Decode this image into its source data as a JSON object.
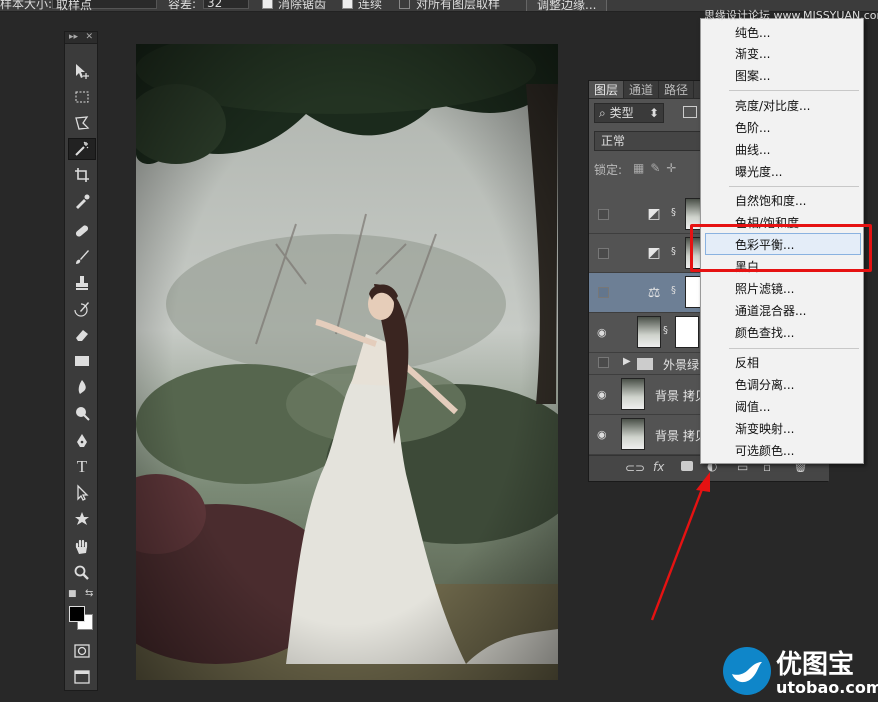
{
  "options_bar": {
    "sample_size_label": "样本大小:",
    "sample_size_value": "取样点",
    "tolerance_label": "容差:",
    "tolerance_value": "32",
    "antialias_label": "消除锯齿",
    "contiguous_label": "连续",
    "all_layers_label": "对所有图层取样",
    "refine_edge_label": "调整边缘..."
  },
  "tools_panel": {
    "header_left": "▸▸",
    "header_right": "✕",
    "tools": [
      "move",
      "marquee",
      "lasso",
      "magic-wand",
      "crop",
      "eyedropper",
      "healing-brush",
      "brush",
      "clone-stamp",
      "history-brush",
      "eraser",
      "gradient",
      "blur",
      "dodge",
      "pen",
      "type",
      "path-selection",
      "shape",
      "hand",
      "zoom"
    ],
    "selected_tool": "magic-wand",
    "foreground_color": "#000000",
    "background_color": "#ffffff"
  },
  "layers_panel": {
    "tabs": [
      "图层",
      "通道",
      "路径"
    ],
    "active_tab": "图层",
    "filter_label": "类型",
    "blend_mode": "正常",
    "lock_label": "锁定:",
    "layers": [
      {
        "name": "",
        "visible": false,
        "type": "curves"
      },
      {
        "name": "",
        "visible": false,
        "type": "curves"
      },
      {
        "name": "",
        "visible": false,
        "type": "balance",
        "selected": true
      },
      {
        "name": "",
        "visible": true,
        "type": "photo-mask"
      },
      {
        "name": "外景绿",
        "visible": false,
        "type": "group"
      },
      {
        "name": "背景 拷贝",
        "visible": true,
        "type": "photo"
      },
      {
        "name": "背景 拷贝",
        "visible": true,
        "type": "photo"
      }
    ],
    "footer_fx": "fx"
  },
  "adjustment_menu": {
    "groups": [
      [
        "纯色...",
        "渐变...",
        "图案..."
      ],
      [
        "亮度/对比度...",
        "色阶...",
        "曲线...",
        "曝光度..."
      ],
      [
        "自然饱和度...",
        "色相/饱和度...",
        "色彩平衡...",
        "黑白...",
        "照片滤镜...",
        "通道混合器...",
        "颜色查找..."
      ],
      [
        "反相",
        "色调分离...",
        "阈值...",
        "渐变映射...",
        "可选颜色..."
      ]
    ],
    "highlighted_item": "色彩平衡..."
  },
  "annotations": {
    "highlight_color": "#e61212",
    "arrow_color": "#e61212"
  },
  "watermarks": {
    "top_right": "思缘设计论坛 www.MISSYUAN.com",
    "logo_text": "优图宝",
    "logo_url": "utobao.com"
  }
}
